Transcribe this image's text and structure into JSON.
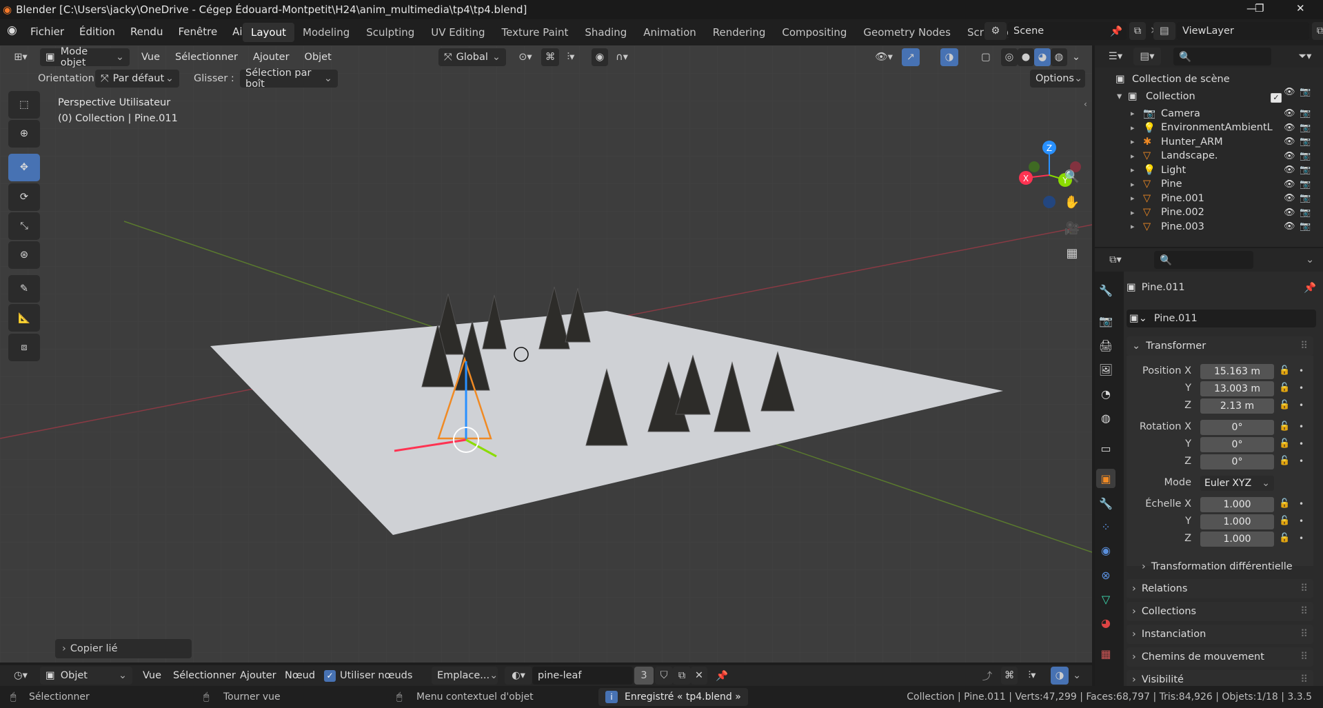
{
  "window": {
    "title": "Blender [C:\\Users\\jacky\\OneDrive - Cégep Édouard-Montpetit\\H24\\anim_multimedia\\tp4\\tp4.blend]",
    "controls": {
      "minimize": "—",
      "maximize": "❐",
      "close": "✕"
    }
  },
  "menubar": {
    "items": [
      "Fichier",
      "Édition",
      "Rendu",
      "Fenêtre",
      "Aide"
    ],
    "workspaces": [
      "Layout",
      "Modeling",
      "Sculpting",
      "UV Editing",
      "Texture Paint",
      "Shading",
      "Animation",
      "Rendering",
      "Compositing",
      "Geometry Nodes",
      "Scripting"
    ],
    "active_workspace": "Layout",
    "add_tab": "+",
    "scene": "Scene",
    "view_layer": "ViewLayer"
  },
  "viewport_header": {
    "mode": "Mode objet",
    "menus": [
      "Vue",
      "Sélectionner",
      "Ajouter",
      "Objet"
    ],
    "transform_orientation": "Global",
    "orientation_label": "Orientation:",
    "orientation_value": "Par défaut",
    "drag_label": "Glisser :",
    "drag_value": "Sélection par boît",
    "options": "Options"
  },
  "viewport": {
    "view_name": "Perspective Utilisateur",
    "collection_info": "(0) Collection | Pine.011",
    "axes": {
      "x": "X",
      "y": "Y",
      "z": "Z"
    },
    "last_operator": "Copier lié"
  },
  "outliner": {
    "root": "Collection de scène",
    "collection": "Collection",
    "items": [
      {
        "name": "Camera",
        "icon": "camera-icon"
      },
      {
        "name": "EnvironmentAmbientL",
        "icon": "light-icon"
      },
      {
        "name": "Hunter_ARM",
        "icon": "armature-icon"
      },
      {
        "name": "Landscape.",
        "icon": "mesh-icon"
      },
      {
        "name": "Light",
        "icon": "light-icon"
      },
      {
        "name": "Pine",
        "icon": "mesh-icon"
      },
      {
        "name": "Pine.001",
        "icon": "mesh-icon"
      },
      {
        "name": "Pine.002",
        "icon": "mesh-icon"
      },
      {
        "name": "Pine.003",
        "icon": "mesh-icon"
      }
    ]
  },
  "properties": {
    "object_name": "Pine.011",
    "object_field": "Pine.011",
    "transform_title": "Transformer",
    "position_label": "Position X",
    "position": [
      "15.163 m",
      "13.003 m",
      "2.13 m"
    ],
    "rotation_label": "Rotation X",
    "rotation": [
      "0°",
      "0°",
      "0°"
    ],
    "mode_label": "Mode",
    "mode_value": "Euler XYZ",
    "scale_label": "Échelle X",
    "scale": [
      "1.000",
      "1.000",
      "1.000"
    ],
    "axis_y": "Y",
    "axis_z": "Z",
    "delta": "Transformation différentielle",
    "panels": [
      "Relations",
      "Collections",
      "Instanciation",
      "Chemins de mouvement",
      "Visibilité"
    ]
  },
  "node_header": {
    "type": "Objet",
    "menus": [
      "Vue",
      "Sélectionner",
      "Ajouter",
      "Nœud"
    ],
    "use_nodes": "Utiliser nœuds",
    "slot": "Emplace...",
    "material": "pine-leaf",
    "users": "3"
  },
  "statusbar": {
    "left": "Sélectionner",
    "middle": "Tourner vue",
    "right": "Menu contextuel d'objet",
    "saved": "Enregistré « tp4.blend »",
    "stats": "Collection | Pine.011 | Verts:47,299 | Faces:68,797 | Tris:84,926 | Objets:1/18 | 3.3.5"
  },
  "colors": {
    "accent": "#4772b3",
    "selection": "#f08a24",
    "x_axis": "#ff3352",
    "y_axis": "#8bdc00",
    "z_axis": "#2890ff",
    "mesh": "#3ddbb0"
  }
}
